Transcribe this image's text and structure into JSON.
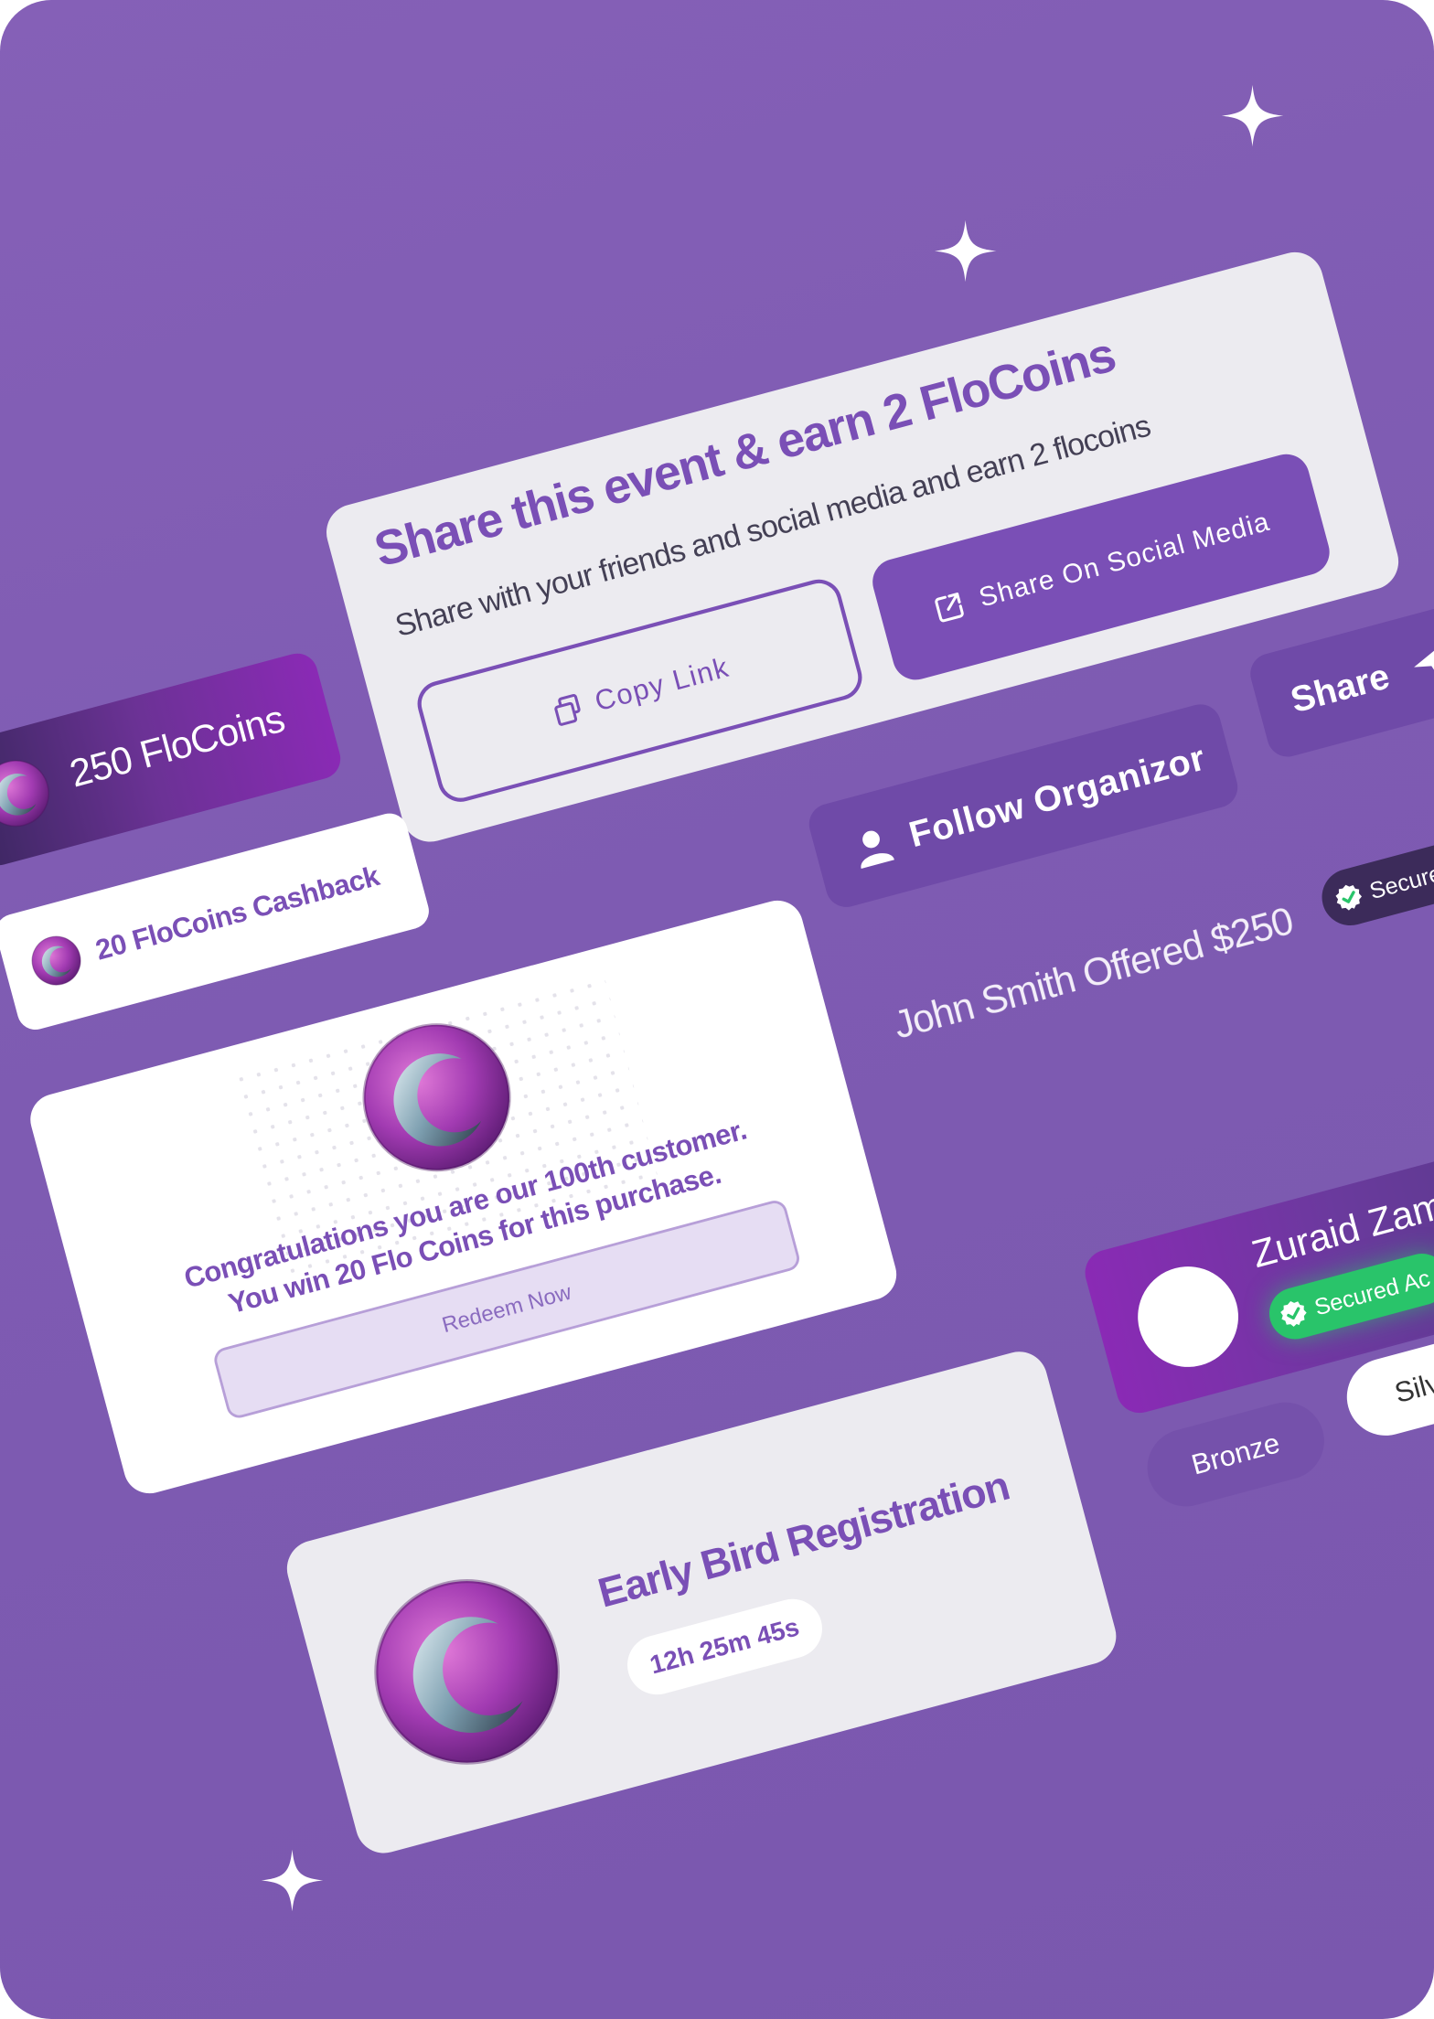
{
  "colors": {
    "background": "#8560b7",
    "accent": "#7a4fb6",
    "card": "#ecebf0",
    "success": "#29c46a"
  },
  "share_card": {
    "title": "Share this event & earn 2 FloCoins",
    "subtitle": "Share with your friends and social media and earn 2 flocoins",
    "copy_label": "Copy Link",
    "social_label": "Share On Social Media"
  },
  "coin_pill": {
    "label": "250 FloCoins"
  },
  "cashback": {
    "label": "20 FloCoins Cashback"
  },
  "congrats": {
    "line1": "Congratulations you are our 100th customer.",
    "line2": "You win 20 Flo Coins for this purchase.",
    "redeem_label": "Redeem Now"
  },
  "early_bird": {
    "title": "Early Bird Registration",
    "timer": "12h 25m 45s"
  },
  "follow": {
    "label": "Follow Organizor"
  },
  "share_button": {
    "label": "Share"
  },
  "secured_small": {
    "label": "Secure"
  },
  "offer": {
    "text": "John Smith Offered $250"
  },
  "profile": {
    "name": "Zuraid Zam",
    "badge": "Secured Ac"
  },
  "tiers": {
    "bronze": "Bronze",
    "silver": "Silv"
  },
  "icons": [
    "sparkle-icon",
    "copy-icon",
    "external-link-icon",
    "user-icon",
    "send-icon",
    "check-badge-icon",
    "flocoin-icon"
  ]
}
